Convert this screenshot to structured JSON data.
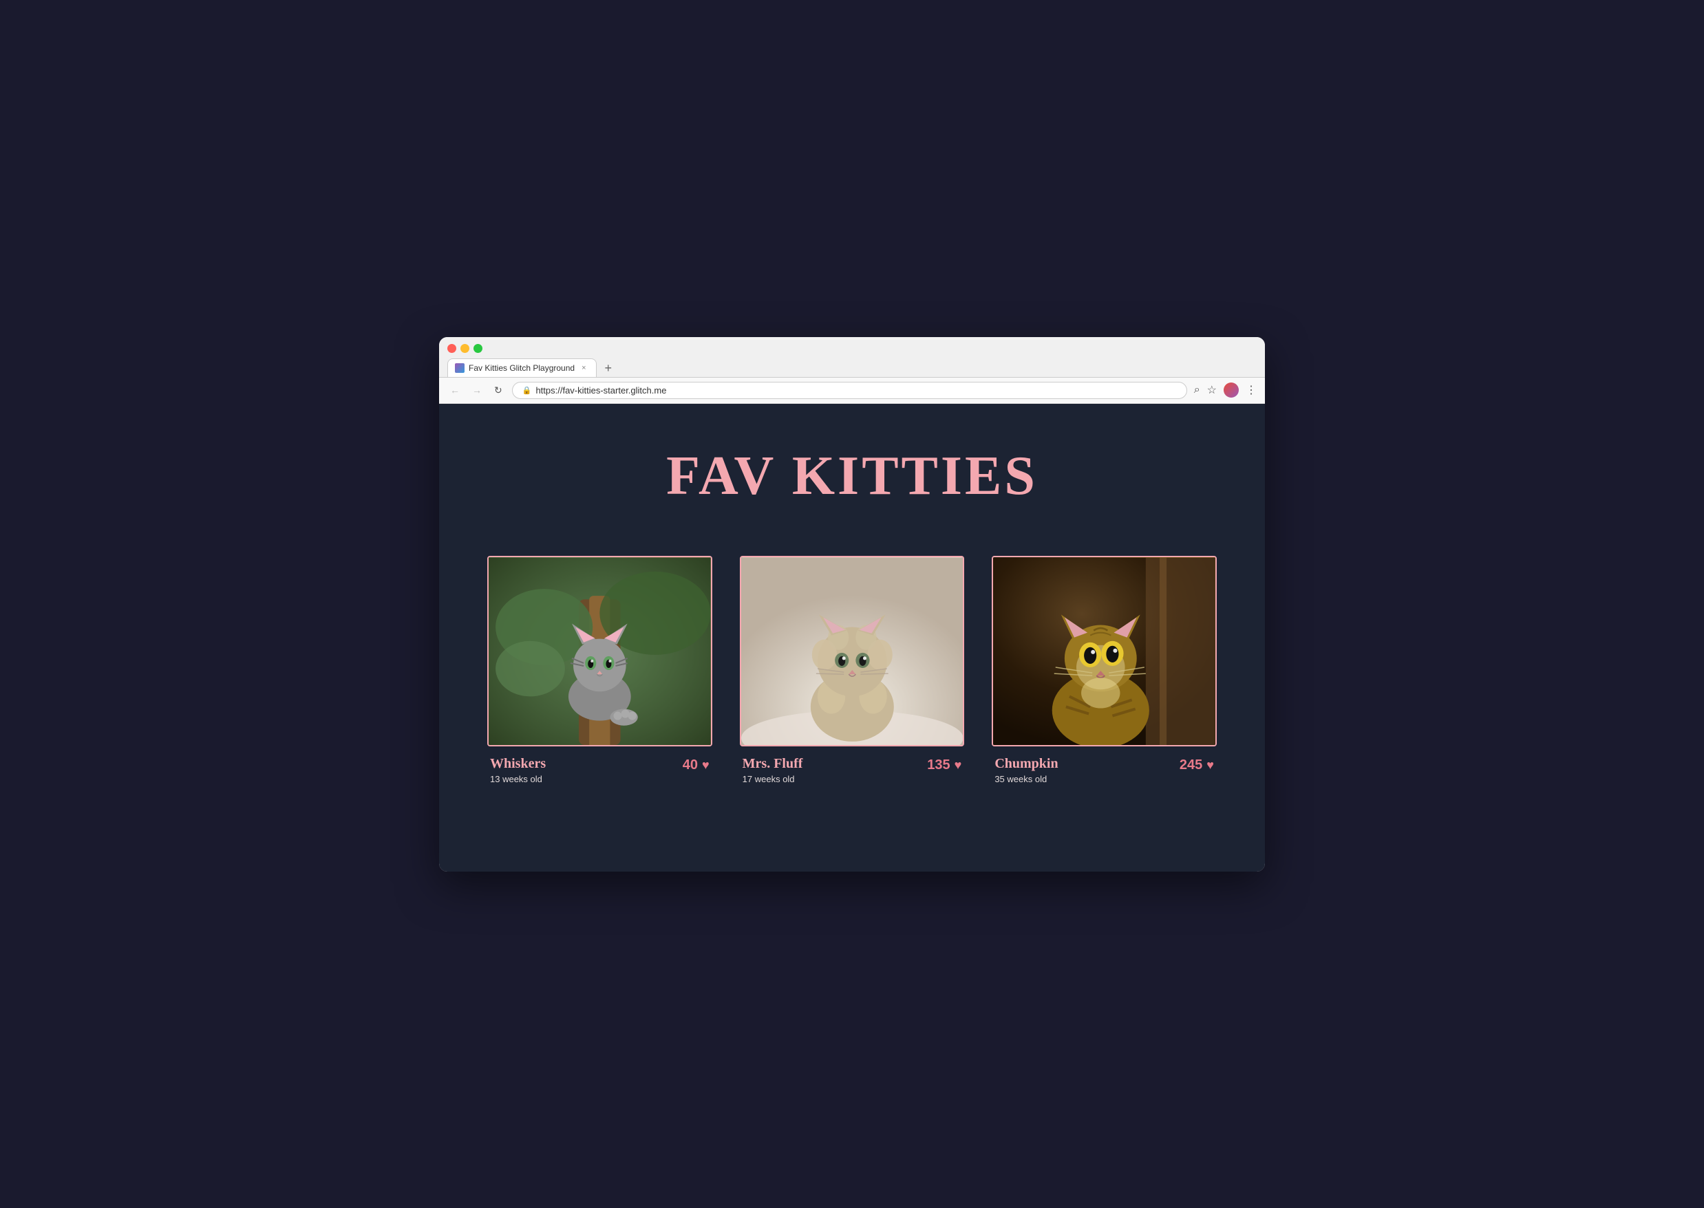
{
  "browser": {
    "tab_title": "Fav Kitties Glitch Playground",
    "tab_close": "×",
    "tab_new": "+",
    "nav_back": "←",
    "nav_forward": "→",
    "nav_refresh": "↻",
    "address_url": "https://fav-kitties-starter.glitch.me",
    "lock_icon": "🔒",
    "search_icon": "⌕",
    "star_icon": "☆",
    "menu_icon": "⋮"
  },
  "page": {
    "title": "FAV KITTIES",
    "background_color": "#1c2333",
    "title_color": "#f4a8b0"
  },
  "kitties": [
    {
      "id": "whiskers",
      "name": "Whiskers",
      "age": "13 weeks old",
      "votes": "40",
      "heart": "♥"
    },
    {
      "id": "mrs-fluff",
      "name": "Mrs. Fluff",
      "age": "17 weeks old",
      "votes": "135",
      "heart": "♥"
    },
    {
      "id": "chumpkin",
      "name": "Chumpkin",
      "age": "35 weeks old",
      "votes": "245",
      "heart": "♥"
    }
  ]
}
